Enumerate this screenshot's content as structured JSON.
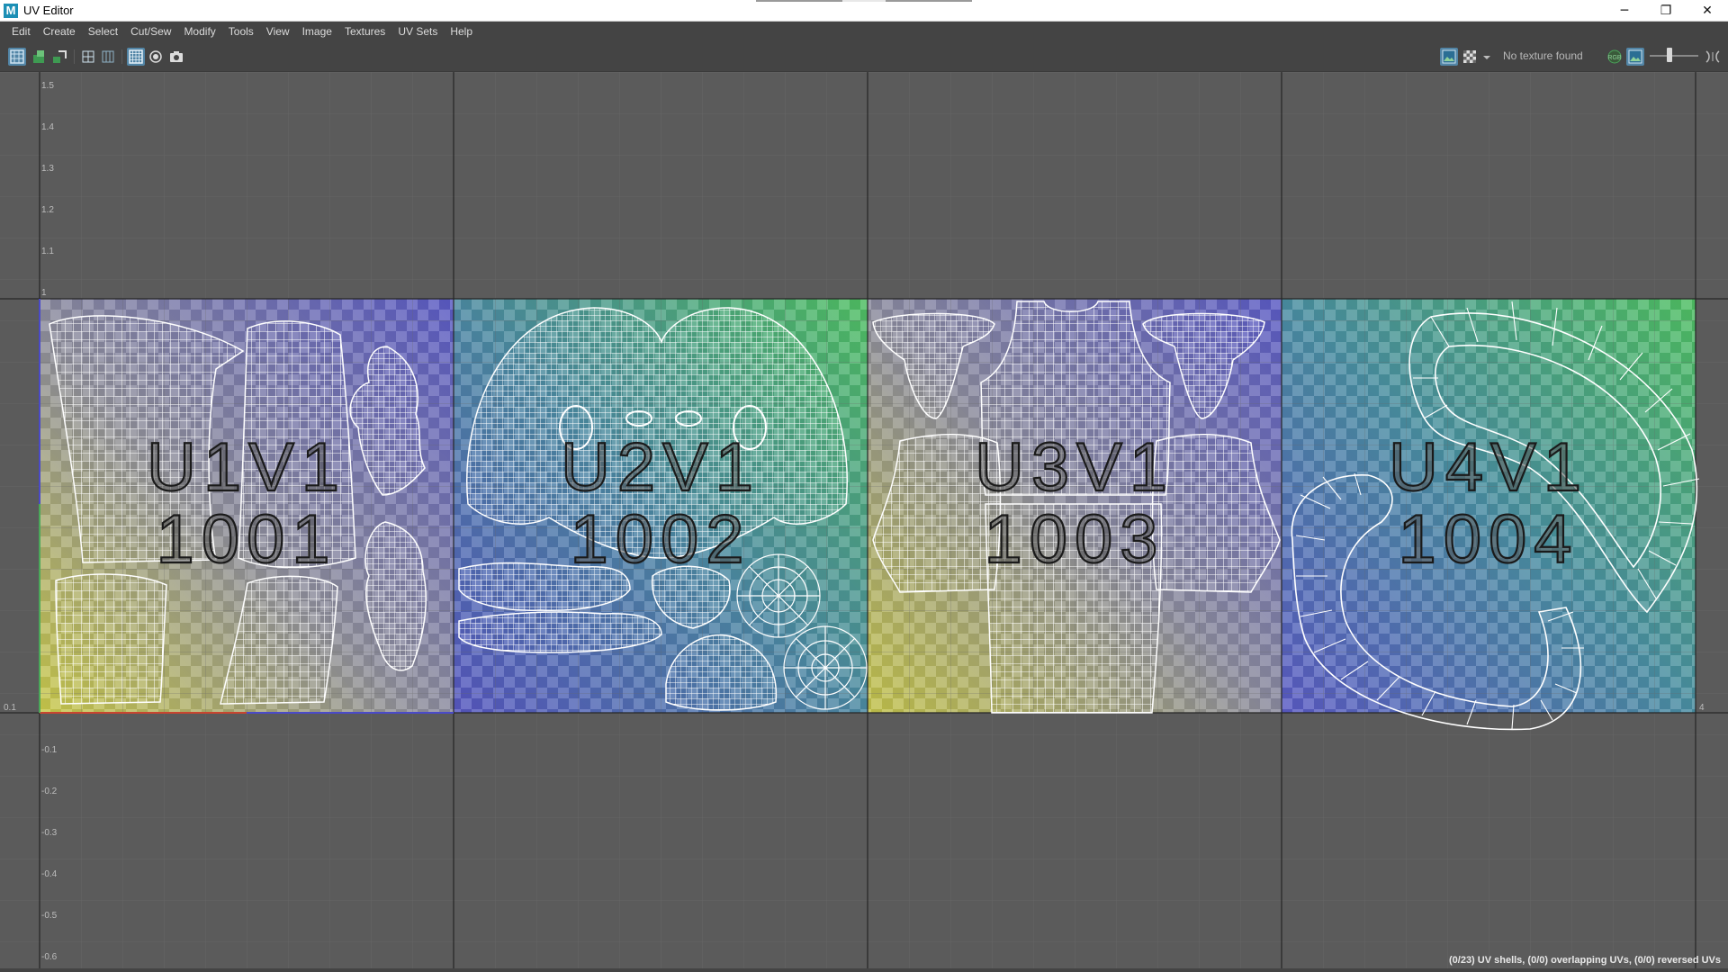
{
  "window": {
    "title": "UV Editor",
    "app_icon": "M",
    "controls": {
      "minimize": "─",
      "restore": "❐",
      "close": "✕"
    }
  },
  "menu": [
    "Edit",
    "Create",
    "Select",
    "Cut/Sew",
    "Modify",
    "Tools",
    "View",
    "Image",
    "Textures",
    "UV Sets",
    "Help"
  ],
  "toolbar": {
    "texture_status": "No texture found",
    "channel_label": "RGB",
    "left_tool_icons": [
      "uv-grid-icon",
      "texel-density-icon",
      "map-uv-icon",
      "grid-toggle-icon",
      "subdivide-grid-icon",
      "grid-display-icon",
      "shading-icon",
      "snapshot-icon"
    ],
    "right_tool_icons": [
      "display-image-icon",
      "checker-icon",
      "options-dropdown-icon",
      "rgb-channel-icon",
      "alpha-channel-icon",
      "exposure-slider-icon",
      "gamma-icon"
    ],
    "exposure_fraction": 0.4
  },
  "uv_axis": {
    "v_labels_top": [
      "1.5",
      "1.4",
      "1.3",
      "1.2",
      "1.1",
      "1"
    ],
    "v_labels_bottom": [
      "-0.1",
      "-0.2",
      "-0.3",
      "-0.4",
      "-0.5",
      "-0.6"
    ],
    "zero_label": "0.1",
    "u_edge_label": "4"
  },
  "udim_tiles": [
    {
      "line1": "U1V1",
      "line2": "1001"
    },
    {
      "line1": "U2V1",
      "line2": "1002"
    },
    {
      "line1": "U3V1",
      "line2": "1003"
    },
    {
      "line1": "U4V1",
      "line2": "1004"
    }
  ],
  "status": {
    "summary": "(0/23) UV shells, (0/0) overlapping UVs, (0/0) reversed UVs"
  },
  "colors": {
    "viewport_bg": "#5b5b5b",
    "panel_bg": "#444444",
    "active_button": "#5285a6",
    "wireframe": "#ffffff"
  }
}
